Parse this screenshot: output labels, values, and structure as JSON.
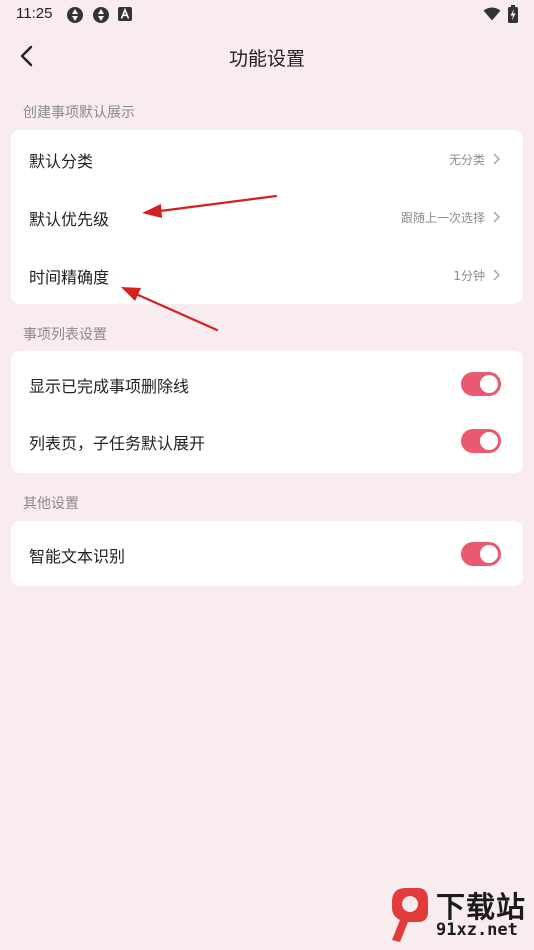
{
  "status_bar": {
    "time": "11:25",
    "left_icons": [
      "sync-icon",
      "sync-icon",
      "notification-a-icon"
    ],
    "right_icons": [
      "wifi-icon",
      "battery-charging-icon"
    ]
  },
  "header": {
    "title": "功能设置",
    "back_icon": "chevron-left-icon"
  },
  "sections": [
    {
      "label": "创建事项默认展示",
      "rows": [
        {
          "label": "默认分类",
          "value": "无分类"
        },
        {
          "label": "默认优先级",
          "value": "跟随上一次选择"
        },
        {
          "label": "时间精确度",
          "value": "1分钟"
        }
      ]
    },
    {
      "label": "事项列表设置",
      "rows": [
        {
          "label": "显示已完成事项删除线",
          "toggle": true
        },
        {
          "label": "列表页，子任务默认展开",
          "toggle": true
        }
      ]
    },
    {
      "label": "其他设置",
      "rows": [
        {
          "label": "智能文本识别",
          "toggle": true
        }
      ]
    }
  ],
  "watermark": {
    "title": "下载站",
    "domain": "91xz.net"
  },
  "colors": {
    "background": "#f8ecee",
    "card": "#ffffff",
    "toggle_on": "#e95a70",
    "annotation_arrow": "#d42020"
  }
}
